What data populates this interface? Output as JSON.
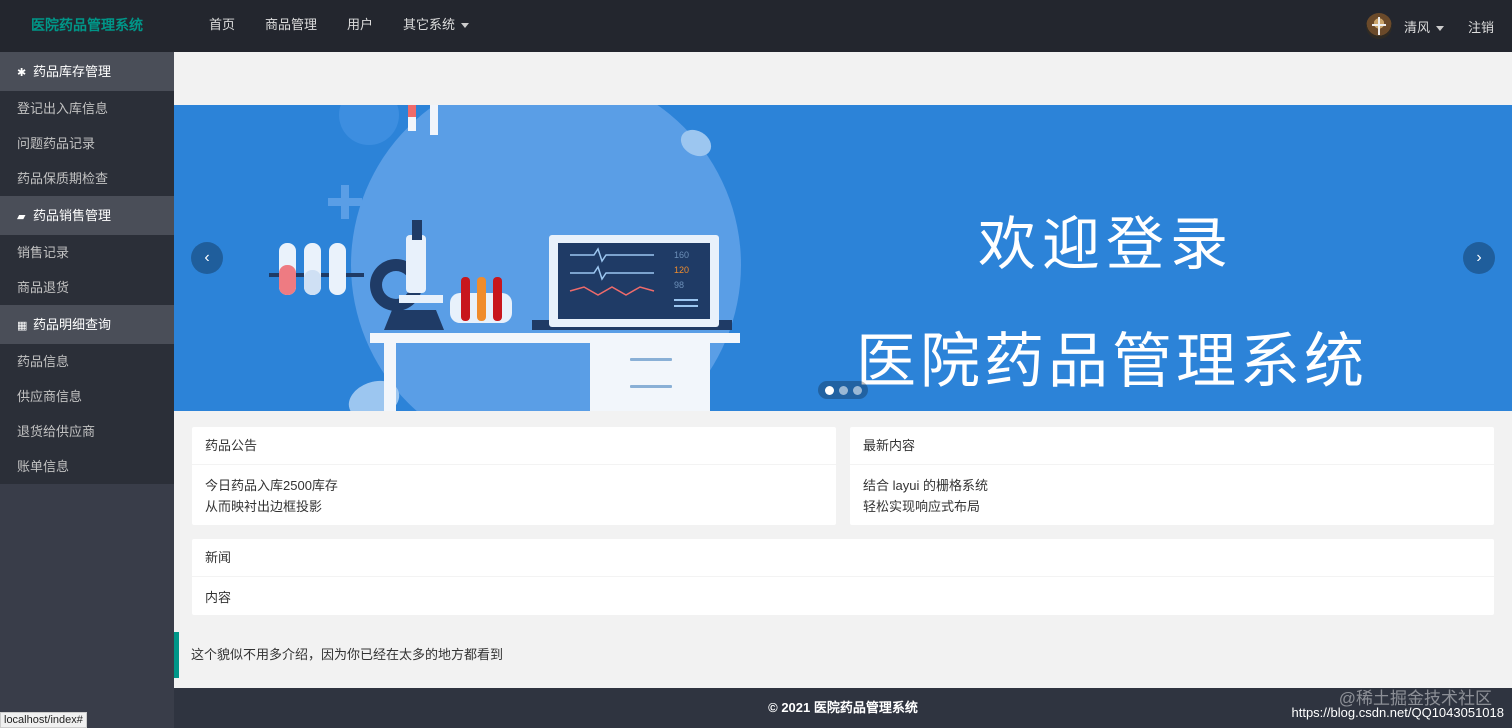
{
  "header": {
    "logo": "医院药品管理系统",
    "nav": [
      {
        "label": "首页"
      },
      {
        "label": "商品管理"
      },
      {
        "label": "用户"
      },
      {
        "label": "其它系统"
      }
    ],
    "user_name": "清风",
    "logout": "注销"
  },
  "sidebar": {
    "groups": [
      {
        "title": "药品库存管理",
        "icon": "gear-icon",
        "items": [
          "登记出入库信息",
          "问题药品记录",
          "药品保质期检查"
        ]
      },
      {
        "title": "药品销售管理",
        "icon": "chat-icon",
        "items": [
          "销售记录",
          "商品退货"
        ]
      },
      {
        "title": "药品明细查询",
        "icon": "grid-icon",
        "items": [
          "药品信息",
          "供应商信息",
          "退货给供应商",
          "账单信息"
        ]
      }
    ]
  },
  "banner": {
    "welcome": "欢迎登录",
    "system_name": "医院药品管理系统",
    "monitor_values": [
      "160",
      "120",
      "98"
    ],
    "slide_count": 3,
    "active_slide": 1
  },
  "cards": {
    "notice": {
      "title": "药品公告",
      "lines": [
        "今日药品入库2500库存",
        "从而映衬出边框投影"
      ]
    },
    "latest": {
      "title": "最新内容",
      "lines": [
        "结合 layui 的栅格系统",
        "轻松实现响应式布局"
      ]
    },
    "news": {
      "title": "新闻",
      "body": "内容"
    }
  },
  "quote": "这个貌似不用多介绍，因为你已经在太多的地方都看到",
  "footer": "© 2021 医院药品管理系统",
  "watermark": {
    "line1": "@稀土掘金技术社区",
    "line2": "https://blog.csdn.net/QQ1043051018"
  },
  "statusbar": "localhost/index#",
  "colors": {
    "header_bg": "#23262e",
    "logo": "#009688",
    "sidebar_bg": "#393d49",
    "banner_bg": "#2c83d8",
    "accent": "#009688"
  }
}
